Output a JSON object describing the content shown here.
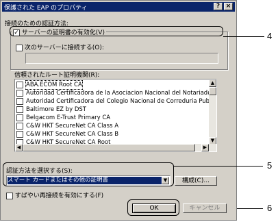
{
  "window": {
    "title": "保護された EAP のプロパティ",
    "help_button": "?",
    "close_button": "×"
  },
  "connect_section": {
    "heading": "接続のための認証方法:",
    "validate_cert_label": "サーバーの証明書の有効化(V)",
    "validate_cert_checked": true,
    "connect_servers_label": "次のサーバーに接続する(O):",
    "connect_servers_checked": false,
    "servers_value": ""
  },
  "trusted_ca": {
    "heading": "信頼されたルート証明機関(R):",
    "items": [
      {
        "label": "ABA.ECOM Root CA",
        "checked": false
      },
      {
        "label": "Autoridad Certificadora de la Asociacion Nacional del Notariado Mex",
        "checked": false
      },
      {
        "label": "Autoridad Certificadora del Colegio Nacional de Correduria Publica M",
        "checked": false
      },
      {
        "label": "Baltimore EZ by DST",
        "checked": false
      },
      {
        "label": "Belgacom E-Trust Primary CA",
        "checked": false
      },
      {
        "label": "C&W HKT SecureNet CA Class A",
        "checked": false
      },
      {
        "label": "C&W HKT SecureNet CA Class B",
        "checked": false
      },
      {
        "label": "C&W HKT SecureNet CA Root",
        "checked": false
      }
    ]
  },
  "auth_method": {
    "heading": "認証方法を選択する(S):",
    "selected": "スマート カードまたはその他の証明書",
    "configure_button": "構成(C)...",
    "fast_reconnect_label": "すばやい再接続を有効にする(F)",
    "fast_reconnect_checked": false
  },
  "footer": {
    "ok_button": "OK",
    "cancel_button": "キャンセル"
  },
  "callouts": {
    "callout_4": "4",
    "callout_5": "5",
    "callout_6": "6"
  },
  "colors": {
    "dialog_face": "#d4d0c8",
    "titlebar": "#0a246a",
    "selection": "#0a246a"
  }
}
